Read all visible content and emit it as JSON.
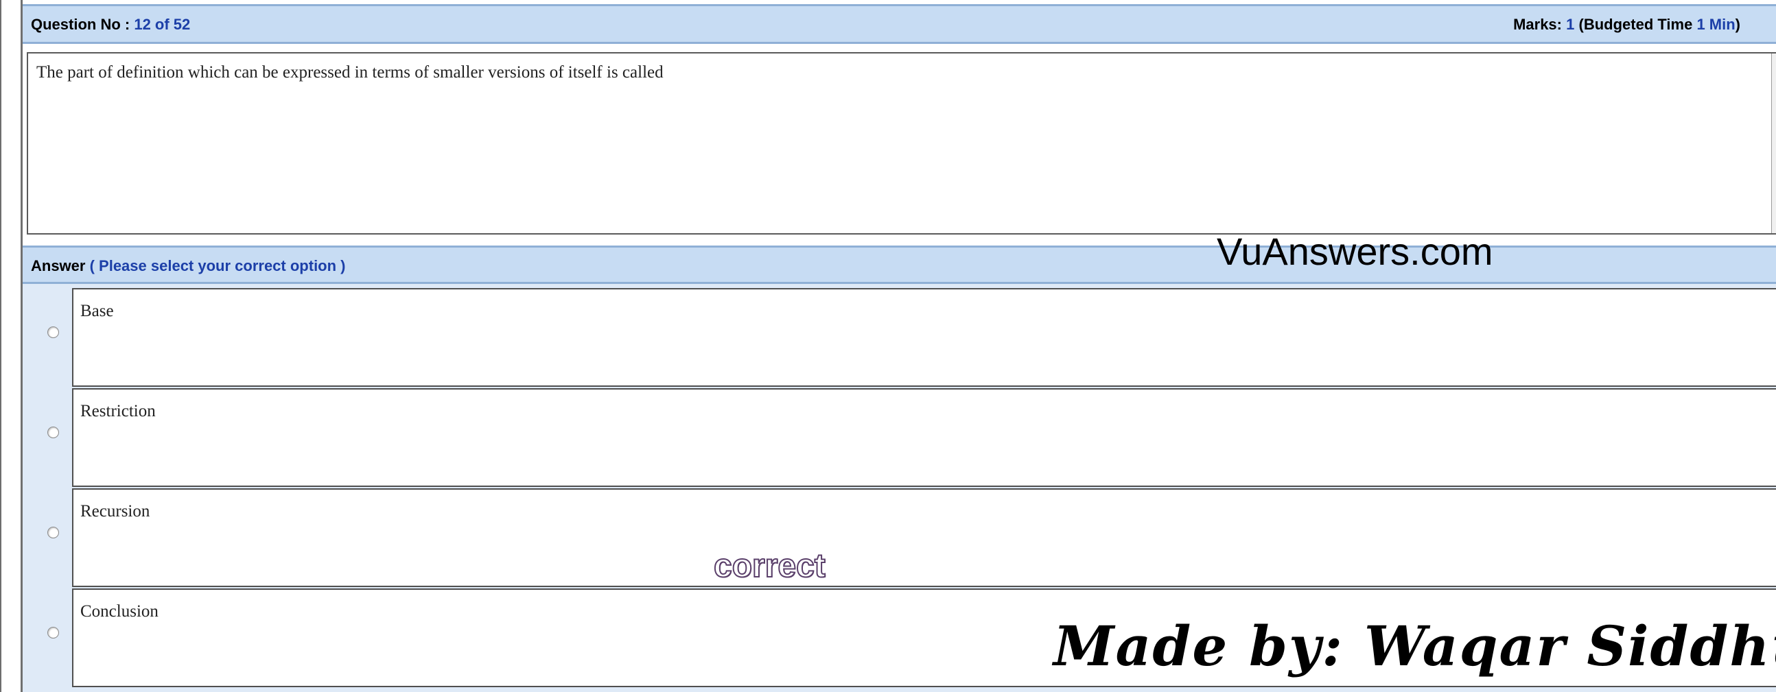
{
  "header": {
    "question_label": "Question No : ",
    "question_number": "12 of 52",
    "marks_label": "Marks: ",
    "marks_value": "1",
    "budget_label": " (Budgeted Time ",
    "budget_value": "1 Min",
    "budget_close": ")"
  },
  "question": {
    "text": "The part of definition which can be expressed in terms of smaller versions of itself is called"
  },
  "answer": {
    "label": "Answer",
    "instruction": " ( Please select your correct option )"
  },
  "options": [
    {
      "label": "Base"
    },
    {
      "label": "Restriction"
    },
    {
      "label": "Recursion"
    },
    {
      "label": "Conclusion"
    }
  ],
  "watermarks": {
    "site": "VuAnswers.com",
    "correct": "correct",
    "author": "Made by: Waqar Siddhu"
  },
  "colors": {
    "header_bg": "#c7dcf3",
    "accent_blue": "#1c3fa8",
    "options_bg": "#dfeaf7"
  }
}
